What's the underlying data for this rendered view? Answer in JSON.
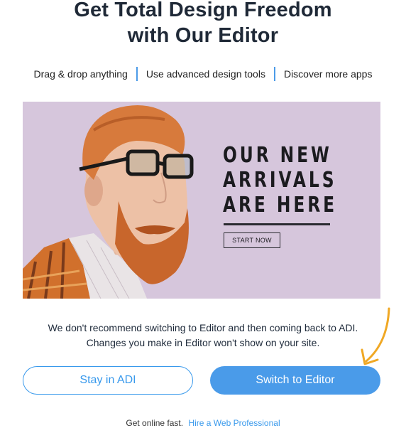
{
  "dialog": {
    "title_line1": "Get Total Design Freedom",
    "title_line2": "with Our Editor"
  },
  "features": [
    "Drag & drop anything",
    "Use advanced design tools",
    "Discover more apps"
  ],
  "banner": {
    "headline": [
      "OUR NEW",
      "ARRIVALS",
      "ARE HERE"
    ],
    "cta": "START NOW"
  },
  "notice": {
    "line1": "We don't recommend switching to Editor and then coming back to ADI.",
    "line2": "Changes you make in Editor won't show on your site."
  },
  "buttons": {
    "stay": "Stay in ADI",
    "switch": "Switch to Editor"
  },
  "footer": {
    "text": "Get online fast.",
    "link": "Hire a Web Professional"
  },
  "colors": {
    "accent": "#3899ec",
    "primary_button": "#4a9be9",
    "banner_bg": "#d6c6dc",
    "arrow": "#f0a824"
  },
  "icons": {
    "annotation": "orange-arrow-icon"
  }
}
